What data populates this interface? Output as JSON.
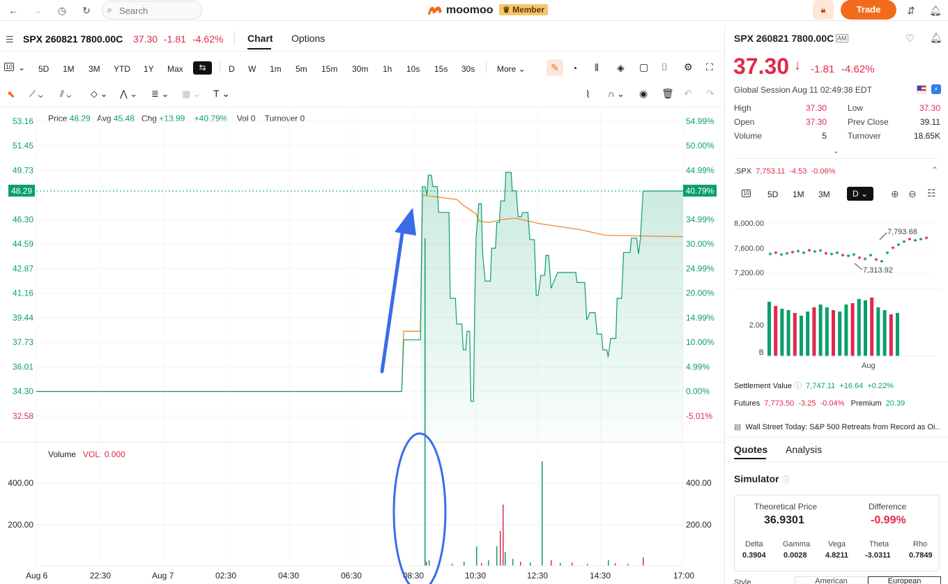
{
  "topbar": {
    "search_placeholder": "Search",
    "brand": "moomoo",
    "member": "Member",
    "trade": "Trade",
    "brand_color": "#f26a1b"
  },
  "chart_header": {
    "symbol": "SPX 260821 7800.00C",
    "price": "37.30",
    "change": "-1.81",
    "change_pct": "-4.62%",
    "tabs": [
      "Chart",
      "Options"
    ]
  },
  "toolbar": {
    "ranges": [
      "5D",
      "1M",
      "3M",
      "YTD",
      "1Y",
      "Max"
    ],
    "intervals": [
      "D",
      "W",
      "1m",
      "5m",
      "15m",
      "30m",
      "1h",
      "10s",
      "15s",
      "30s"
    ],
    "more": "More",
    "period_sel": "10"
  },
  "info_bar": {
    "price_label": "Price",
    "price": "48.29",
    "avg_label": "Avg",
    "avg": "45.48",
    "chg_label": "Chg",
    "chg": "+13.99",
    "chg_pct": "+40.79%",
    "vol_label": "Vol",
    "vol": "0",
    "turnover_label": "Turnover",
    "turnover": "0"
  },
  "volume_bar": {
    "label": "Volume",
    "vol": "VOL: 0.000"
  },
  "chart_data": {
    "type": "line",
    "price_axis_left": [
      "53.16",
      "51.45",
      "49.73",
      "48.29",
      "46.30",
      "44.59",
      "42.87",
      "41.16",
      "39.44",
      "37.73",
      "36.01",
      "34.30",
      "32.58"
    ],
    "price_axis_right": [
      "54.99%",
      "50.00%",
      "44.99%",
      "40.79%",
      "34.99%",
      "30.00%",
      "24.99%",
      "20.00%",
      "14.99%",
      "10.00%",
      "4.99%",
      "0.00%",
      "-5.01%"
    ],
    "volume_axis": [
      "400.00",
      "200.00"
    ],
    "x_labels": [
      "Aug 6",
      "22:30",
      "Aug 7",
      "02:30",
      "04:30",
      "06:30",
      "08:30",
      "10:30",
      "12:30",
      "14:30",
      "17:00"
    ],
    "last_price": 48.29,
    "base_price": 34.3,
    "line_color": "#0a9e6a",
    "avg_color": "#f08a2c"
  },
  "quote": {
    "symbol": "SPX 260821 7800.00C",
    "am": "AM",
    "price": "37.30",
    "arrow": "↓",
    "change": "-1.81",
    "change_pct": "-4.62%",
    "session": "Global Session Aug 11 02:49:38 EDT",
    "high_label": "High",
    "high": "37.30",
    "low_label": "Low",
    "low": "37.30",
    "open_label": "Open",
    "open": "37.30",
    "prev_label": "Prev Close",
    "prev": "39.11",
    "volume_label": "Volume",
    "volume": "5",
    "turnover_label": "Turnover",
    "turnover": "18.65K"
  },
  "underlying": {
    "name": ".SPX",
    "price": "7,753.11",
    "change": "-4.53",
    "pct": "-0.06%",
    "tabs": [
      "10",
      "5D",
      "1M",
      "3M",
      "D"
    ],
    "y_labels": [
      "8,000.00",
      "7,600.00",
      "7,200.00"
    ],
    "high_label": "7,793.68",
    "low_label": "7,313.92",
    "vol_labels": [
      "2.00",
      "B"
    ],
    "x_label": "Aug"
  },
  "settlement": {
    "label": "Settlement Value",
    "value": "7,747.11",
    "change": "+16.64",
    "pct": "+0.22%"
  },
  "futures": {
    "label": "Futures",
    "value": "7,773.50",
    "change": "-3.25",
    "pct": "-0.04%",
    "premium_label": "Premium",
    "premium": "20.39"
  },
  "news": "Wall Street Today: S&P 500 Retreats from Record as Oi...",
  "quote_tabs": [
    "Quotes",
    "Analysis"
  ],
  "simulator": {
    "title": "Simulator",
    "theo_label": "Theoretical Price",
    "theo": "36.9301",
    "diff_label": "Difference",
    "diff": "-0.99%",
    "greeks": [
      {
        "name": "Delta",
        "value": "0.3904"
      },
      {
        "name": "Gamma",
        "value": "0.0028"
      },
      {
        "name": "Vega",
        "value": "4.8211"
      },
      {
        "name": "Theta",
        "value": "-3.0311"
      },
      {
        "name": "Rho",
        "value": "0.7849"
      }
    ]
  },
  "bottom": {
    "style": "Style",
    "american": "American",
    "european": "European"
  }
}
